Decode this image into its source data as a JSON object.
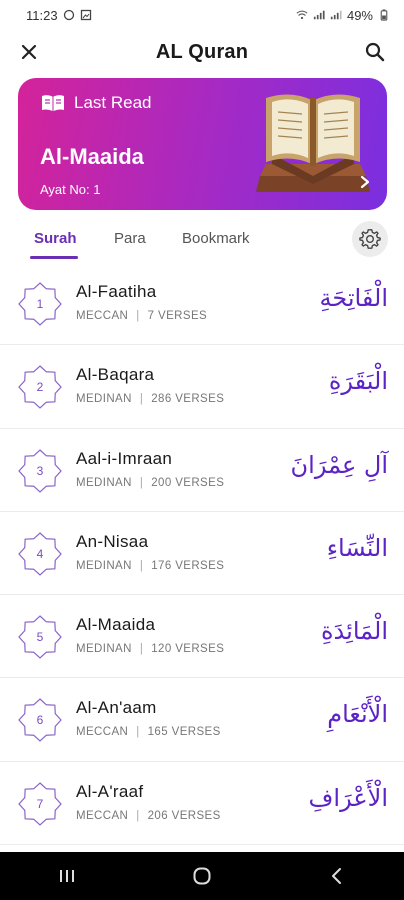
{
  "status_bar": {
    "time": "11:23",
    "battery": "49%"
  },
  "app_bar": {
    "title": "AL Quran",
    "close_icon": "close-icon",
    "search_icon": "search-icon"
  },
  "last_read": {
    "heading": "Last Read",
    "surah": "Al-Maaida",
    "ayat": "Ayat No: 1",
    "colors": {
      "start": "#d4239a",
      "end": "#7a2fe0"
    }
  },
  "tabs": [
    {
      "label": "Surah",
      "active": true
    },
    {
      "label": "Para",
      "active": false
    },
    {
      "label": "Bookmark",
      "active": false
    }
  ],
  "accent_color": "#6b2fb3",
  "surahs": [
    {
      "number": "1",
      "name": "Al-Faatiha",
      "type": "MECCAN",
      "verses": "7 VERSES",
      "arabic": "الْفَاتِحَةِ"
    },
    {
      "number": "2",
      "name": "Al-Baqara",
      "type": "MEDINAN",
      "verses": "286 VERSES",
      "arabic": "الْبَقَرَةِ"
    },
    {
      "number": "3",
      "name": "Aal-i-Imraan",
      "type": "MEDINAN",
      "verses": "200 VERSES",
      "arabic": "آلِ عِمْرَانَ"
    },
    {
      "number": "4",
      "name": "An-Nisaa",
      "type": "MEDINAN",
      "verses": "176 VERSES",
      "arabic": "النِّسَاءِ"
    },
    {
      "number": "5",
      "name": "Al-Maaida",
      "type": "MEDINAN",
      "verses": "120 VERSES",
      "arabic": "الْمَائِدَةِ"
    },
    {
      "number": "6",
      "name": "Al-An'aam",
      "type": "MECCAN",
      "verses": "165 VERSES",
      "arabic": "الْأَنْعَامِ"
    },
    {
      "number": "7",
      "name": "Al-A'raaf",
      "type": "MECCAN",
      "verses": "206 VERSES",
      "arabic": "الْأَعْرَافِ"
    }
  ]
}
